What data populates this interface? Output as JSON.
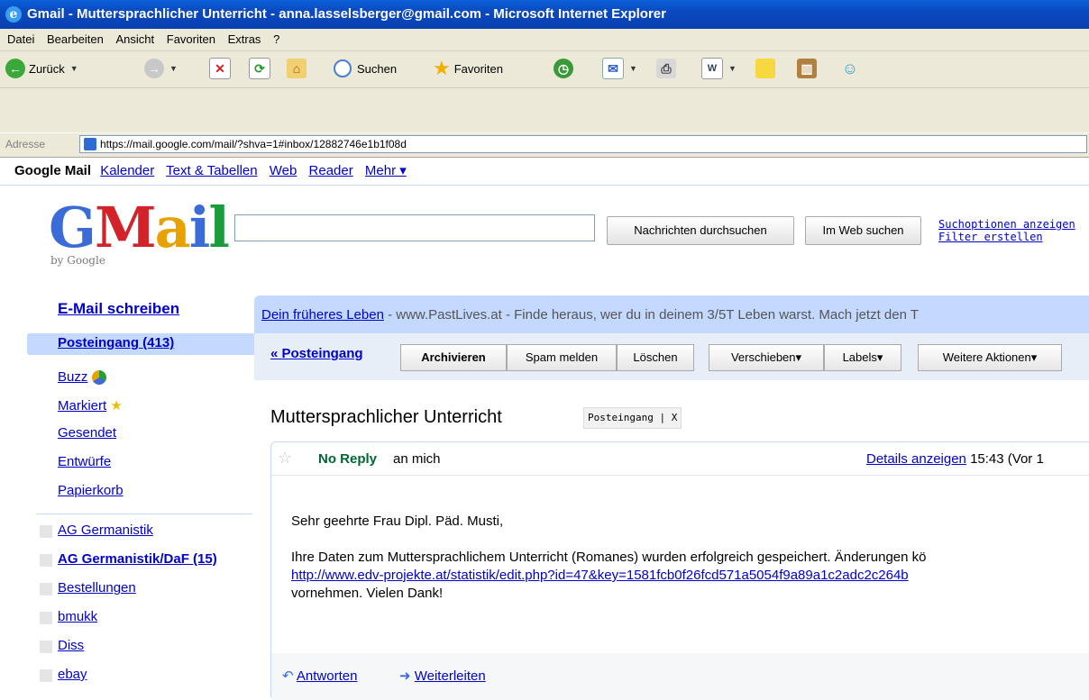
{
  "window": {
    "title": "Gmail - Muttersprachlicher Unterricht - anna.lasselsberger@gmail.com - Microsoft Internet Explorer"
  },
  "menu": [
    "Datei",
    "Bearbeiten",
    "Ansicht",
    "Favoriten",
    "Extras",
    "?"
  ],
  "toolbar": {
    "back": "Zurück",
    "search": "Suchen",
    "favorites": "Favoriten"
  },
  "address": {
    "label": "Adresse",
    "url": "https://mail.google.com/mail/?shva=1#inbox/12882746e1b1f08d"
  },
  "gbar": {
    "current": "Google Mail",
    "links": [
      "Kalender",
      "Text & Tabellen",
      "Web",
      "Reader",
      "Mehr ▾"
    ]
  },
  "logo": {
    "by": "by Google"
  },
  "search": {
    "mail_button": "Nachrichten durchsuchen",
    "web_button": "Im Web suchen",
    "options": "Suchoptionen anzeigen",
    "filter": "Filter erstellen"
  },
  "nav": {
    "compose": "E-Mail schreiben",
    "inbox": "Posteingang (413)",
    "items": [
      "Buzz",
      "Markiert",
      "Gesendet",
      "Entwürfe",
      "Papierkorb"
    ],
    "labels": [
      "AG Germanistik",
      "AG Germanistik/DaF (15)",
      "Bestellungen",
      "bmukk",
      "Diss",
      "ebay"
    ]
  },
  "ad": {
    "link": "Dein früheres Leben",
    "text": " - www.PastLives.at - Finde heraus, wer du in deinem 3/5T Leben warst. Mach jetzt den T"
  },
  "actions": {
    "back": "« Posteingang",
    "archive": "Archivieren",
    "spam": "Spam melden",
    "delete": "Löschen",
    "move": "Verschieben▾",
    "labels": "Labels▾",
    "more": "Weitere Aktionen▾"
  },
  "message": {
    "subject": "Muttersprachlicher Unterricht",
    "tag": "Posteingang | X",
    "sender": "No Reply",
    "to": "an mich",
    "details": "Details anzeigen",
    "time": " 15:43 (Vor 1",
    "greeting": "Sehr geehrte Frau Dipl. Päd. Musti,",
    "line1": "Ihre Daten zum Muttersprachlichem Unterricht (Romanes) wurden erfolgreich gespeichert. Änderungen kö",
    "link": "http://www.edv-projekte.at/statistik/edit.php?id=47&key=1581fcb0f26fcd571a5054f9a89a1c2adc2c264b",
    "line3": "vornehmen. Vielen Dank!",
    "reply": "Antworten",
    "forward": "Weiterleiten"
  }
}
